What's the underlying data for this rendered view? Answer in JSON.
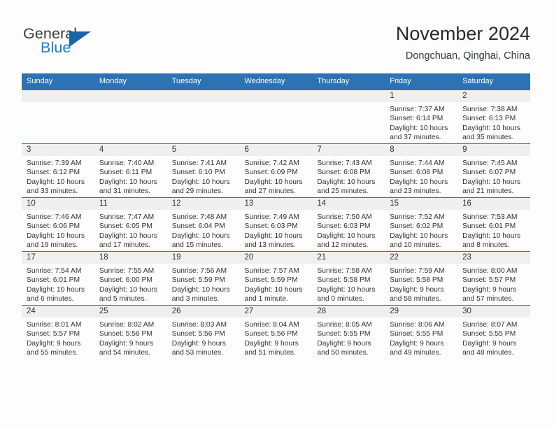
{
  "brand": {
    "name_part1": "General",
    "name_part2": "Blue",
    "triangle_color": "#1565a8",
    "blue_color": "#1a7bc4"
  },
  "header": {
    "title": "November 2024",
    "subtitle": "Dongchuan, Qinghai, China",
    "header_bg": "#2d73b4",
    "header_text_color": "#ffffff"
  },
  "calendar": {
    "weekday_headers": [
      "Sunday",
      "Monday",
      "Tuesday",
      "Wednesday",
      "Thursday",
      "Friday",
      "Saturday"
    ],
    "weeks": [
      [
        {
          "day": "",
          "sunrise": "",
          "sunset": "",
          "daylight1": "",
          "daylight2": ""
        },
        {
          "day": "",
          "sunrise": "",
          "sunset": "",
          "daylight1": "",
          "daylight2": ""
        },
        {
          "day": "",
          "sunrise": "",
          "sunset": "",
          "daylight1": "",
          "daylight2": ""
        },
        {
          "day": "",
          "sunrise": "",
          "sunset": "",
          "daylight1": "",
          "daylight2": ""
        },
        {
          "day": "",
          "sunrise": "",
          "sunset": "",
          "daylight1": "",
          "daylight2": ""
        },
        {
          "day": "1",
          "sunrise": "Sunrise: 7:37 AM",
          "sunset": "Sunset: 6:14 PM",
          "daylight1": "Daylight: 10 hours",
          "daylight2": "and 37 minutes."
        },
        {
          "day": "2",
          "sunrise": "Sunrise: 7:38 AM",
          "sunset": "Sunset: 6:13 PM",
          "daylight1": "Daylight: 10 hours",
          "daylight2": "and 35 minutes."
        }
      ],
      [
        {
          "day": "3",
          "sunrise": "Sunrise: 7:39 AM",
          "sunset": "Sunset: 6:12 PM",
          "daylight1": "Daylight: 10 hours",
          "daylight2": "and 33 minutes."
        },
        {
          "day": "4",
          "sunrise": "Sunrise: 7:40 AM",
          "sunset": "Sunset: 6:11 PM",
          "daylight1": "Daylight: 10 hours",
          "daylight2": "and 31 minutes."
        },
        {
          "day": "5",
          "sunrise": "Sunrise: 7:41 AM",
          "sunset": "Sunset: 6:10 PM",
          "daylight1": "Daylight: 10 hours",
          "daylight2": "and 29 minutes."
        },
        {
          "day": "6",
          "sunrise": "Sunrise: 7:42 AM",
          "sunset": "Sunset: 6:09 PM",
          "daylight1": "Daylight: 10 hours",
          "daylight2": "and 27 minutes."
        },
        {
          "day": "7",
          "sunrise": "Sunrise: 7:43 AM",
          "sunset": "Sunset: 6:08 PM",
          "daylight1": "Daylight: 10 hours",
          "daylight2": "and 25 minutes."
        },
        {
          "day": "8",
          "sunrise": "Sunrise: 7:44 AM",
          "sunset": "Sunset: 6:08 PM",
          "daylight1": "Daylight: 10 hours",
          "daylight2": "and 23 minutes."
        },
        {
          "day": "9",
          "sunrise": "Sunrise: 7:45 AM",
          "sunset": "Sunset: 6:07 PM",
          "daylight1": "Daylight: 10 hours",
          "daylight2": "and 21 minutes."
        }
      ],
      [
        {
          "day": "10",
          "sunrise": "Sunrise: 7:46 AM",
          "sunset": "Sunset: 6:06 PM",
          "daylight1": "Daylight: 10 hours",
          "daylight2": "and 19 minutes."
        },
        {
          "day": "11",
          "sunrise": "Sunrise: 7:47 AM",
          "sunset": "Sunset: 6:05 PM",
          "daylight1": "Daylight: 10 hours",
          "daylight2": "and 17 minutes."
        },
        {
          "day": "12",
          "sunrise": "Sunrise: 7:48 AM",
          "sunset": "Sunset: 6:04 PM",
          "daylight1": "Daylight: 10 hours",
          "daylight2": "and 15 minutes."
        },
        {
          "day": "13",
          "sunrise": "Sunrise: 7:49 AM",
          "sunset": "Sunset: 6:03 PM",
          "daylight1": "Daylight: 10 hours",
          "daylight2": "and 13 minutes."
        },
        {
          "day": "14",
          "sunrise": "Sunrise: 7:50 AM",
          "sunset": "Sunset: 6:03 PM",
          "daylight1": "Daylight: 10 hours",
          "daylight2": "and 12 minutes."
        },
        {
          "day": "15",
          "sunrise": "Sunrise: 7:52 AM",
          "sunset": "Sunset: 6:02 PM",
          "daylight1": "Daylight: 10 hours",
          "daylight2": "and 10 minutes."
        },
        {
          "day": "16",
          "sunrise": "Sunrise: 7:53 AM",
          "sunset": "Sunset: 6:01 PM",
          "daylight1": "Daylight: 10 hours",
          "daylight2": "and 8 minutes."
        }
      ],
      [
        {
          "day": "17",
          "sunrise": "Sunrise: 7:54 AM",
          "sunset": "Sunset: 6:01 PM",
          "daylight1": "Daylight: 10 hours",
          "daylight2": "and 6 minutes."
        },
        {
          "day": "18",
          "sunrise": "Sunrise: 7:55 AM",
          "sunset": "Sunset: 6:00 PM",
          "daylight1": "Daylight: 10 hours",
          "daylight2": "and 5 minutes."
        },
        {
          "day": "19",
          "sunrise": "Sunrise: 7:56 AM",
          "sunset": "Sunset: 5:59 PM",
          "daylight1": "Daylight: 10 hours",
          "daylight2": "and 3 minutes."
        },
        {
          "day": "20",
          "sunrise": "Sunrise: 7:57 AM",
          "sunset": "Sunset: 5:59 PM",
          "daylight1": "Daylight: 10 hours",
          "daylight2": "and 1 minute."
        },
        {
          "day": "21",
          "sunrise": "Sunrise: 7:58 AM",
          "sunset": "Sunset: 5:58 PM",
          "daylight1": "Daylight: 10 hours",
          "daylight2": "and 0 minutes."
        },
        {
          "day": "22",
          "sunrise": "Sunrise: 7:59 AM",
          "sunset": "Sunset: 5:58 PM",
          "daylight1": "Daylight: 9 hours",
          "daylight2": "and 58 minutes."
        },
        {
          "day": "23",
          "sunrise": "Sunrise: 8:00 AM",
          "sunset": "Sunset: 5:57 PM",
          "daylight1": "Daylight: 9 hours",
          "daylight2": "and 57 minutes."
        }
      ],
      [
        {
          "day": "24",
          "sunrise": "Sunrise: 8:01 AM",
          "sunset": "Sunset: 5:57 PM",
          "daylight1": "Daylight: 9 hours",
          "daylight2": "and 55 minutes."
        },
        {
          "day": "25",
          "sunrise": "Sunrise: 8:02 AM",
          "sunset": "Sunset: 5:56 PM",
          "daylight1": "Daylight: 9 hours",
          "daylight2": "and 54 minutes."
        },
        {
          "day": "26",
          "sunrise": "Sunrise: 8:03 AM",
          "sunset": "Sunset: 5:56 PM",
          "daylight1": "Daylight: 9 hours",
          "daylight2": "and 53 minutes."
        },
        {
          "day": "27",
          "sunrise": "Sunrise: 8:04 AM",
          "sunset": "Sunset: 5:56 PM",
          "daylight1": "Daylight: 9 hours",
          "daylight2": "and 51 minutes."
        },
        {
          "day": "28",
          "sunrise": "Sunrise: 8:05 AM",
          "sunset": "Sunset: 5:55 PM",
          "daylight1": "Daylight: 9 hours",
          "daylight2": "and 50 minutes."
        },
        {
          "day": "29",
          "sunrise": "Sunrise: 8:06 AM",
          "sunset": "Sunset: 5:55 PM",
          "daylight1": "Daylight: 9 hours",
          "daylight2": "and 49 minutes."
        },
        {
          "day": "30",
          "sunrise": "Sunrise: 8:07 AM",
          "sunset": "Sunset: 5:55 PM",
          "daylight1": "Daylight: 9 hours",
          "daylight2": "and 48 minutes."
        }
      ]
    ]
  }
}
